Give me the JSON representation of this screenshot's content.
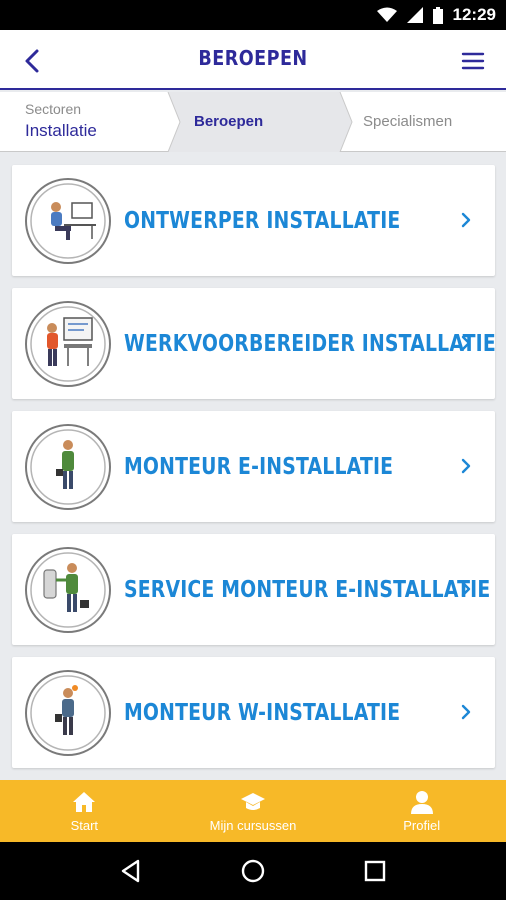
{
  "status_bar": {
    "time": "12:29"
  },
  "header": {
    "title": "BEROEPEN"
  },
  "breadcrumb": {
    "sector_caption": "Sectoren",
    "sector_value": "Installatie",
    "current": "Beroepen",
    "next": "Specialismen"
  },
  "professions": [
    {
      "label": "ONTWERPER INSTALLATIE",
      "icon": "designer-at-desk-illustration"
    },
    {
      "label": "WERKVOORBEREIDER INSTALLATIE",
      "icon": "planner-at-board-illustration"
    },
    {
      "label": "MONTEUR E-INSTALLATIE",
      "icon": "electrician-illustration"
    },
    {
      "label": "SERVICE MONTEUR E-INSTALLATIE",
      "icon": "service-electrician-illustration"
    },
    {
      "label": "MONTEUR W-INSTALLATIE",
      "icon": "plumber-illustration"
    }
  ],
  "bottom_nav": [
    {
      "label": "Start",
      "icon": "home-icon"
    },
    {
      "label": "Mijn cursussen",
      "icon": "graduation-cap-icon"
    },
    {
      "label": "Profiel",
      "icon": "user-icon"
    }
  ],
  "colors": {
    "primary": "#2e2a9a",
    "link": "#1c87d6",
    "accent": "#f7b928",
    "background": "#e9ebee"
  }
}
